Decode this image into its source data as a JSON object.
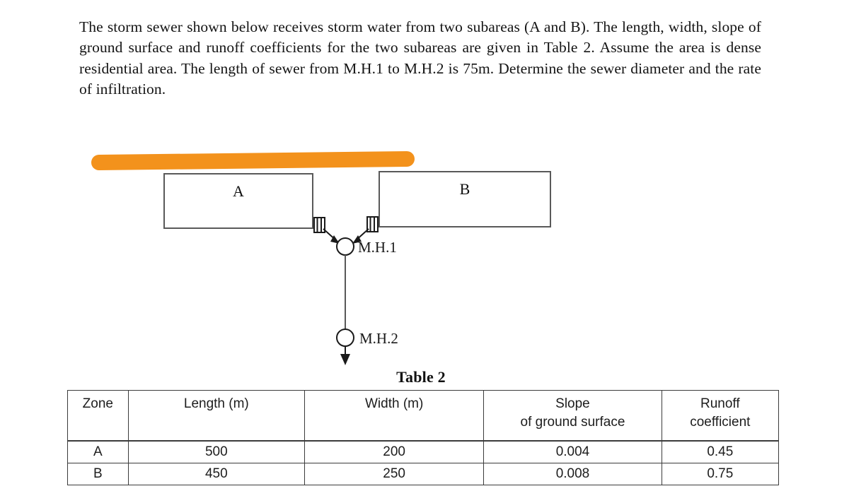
{
  "problem": {
    "text": "The storm sewer shown below receives storm water from two subareas (A and B). The length, width, slope of ground surface and runoff coefficients for the two subareas are given in Table 2. Assume the area is dense residential area. The length of sewer from M.H.1 to M.H.2 is 75m. Determine the sewer diameter and the rate of infiltration."
  },
  "diagram": {
    "subarea_a_label": "A",
    "subarea_b_label": "B",
    "manhole1_label": "M.H.1",
    "manhole2_label": "M.H.2",
    "highlight_color": "#F3921C",
    "line_color": "#595959"
  },
  "table": {
    "caption": "Table 2",
    "headers": [
      {
        "line1": "Zone",
        "line2": ""
      },
      {
        "line1": "Length (m)",
        "line2": ""
      },
      {
        "line1": "Width (m)",
        "line2": ""
      },
      {
        "line1": "Slope",
        "line2": "of ground surface"
      },
      {
        "line1": "Runoff",
        "line2": "coefficient"
      }
    ],
    "rows": [
      {
        "zone": "A",
        "length": "500",
        "width": "200",
        "slope": "0.004",
        "runoff": "0.45"
      },
      {
        "zone": "B",
        "length": "450",
        "width": "250",
        "slope": "0.008",
        "runoff": "0.75"
      }
    ]
  }
}
